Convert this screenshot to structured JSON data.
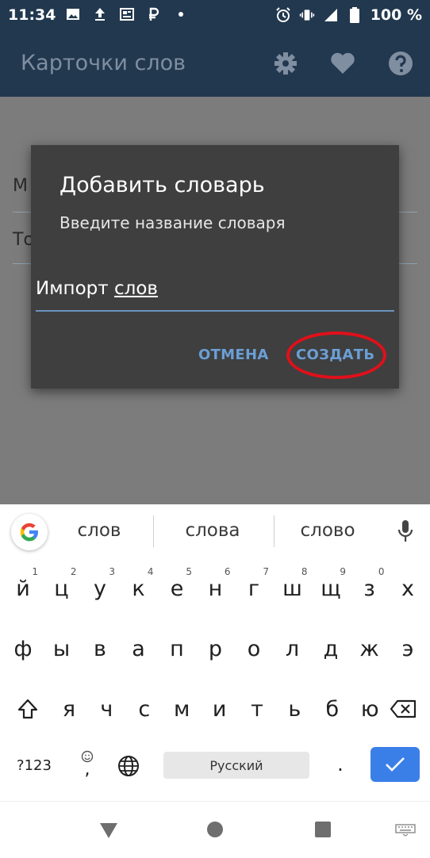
{
  "status_bar": {
    "time": "11:34",
    "battery": "100 %"
  },
  "app_bar": {
    "title": "Карточки слов",
    "icons": [
      "settings-icon",
      "heart-icon",
      "help-icon"
    ]
  },
  "background_list": {
    "items": [
      "М",
      "То"
    ]
  },
  "dialog": {
    "title": "Добавить словарь",
    "message": "Введите название словаря",
    "input_word1": "Импорт",
    "input_word2": "слов",
    "cancel_label": "ОТМЕНА",
    "create_label": "СОЗДАТЬ"
  },
  "keyboard": {
    "suggestions": [
      "слов",
      "слова",
      "слово"
    ],
    "row1": [
      "й",
      "ц",
      "у",
      "к",
      "е",
      "н",
      "г",
      "ш",
      "щ",
      "з",
      "х"
    ],
    "row1_hints": [
      "1",
      "2",
      "3",
      "4",
      "5",
      "6",
      "7",
      "8",
      "9",
      "0",
      ""
    ],
    "row2": [
      "ф",
      "ы",
      "в",
      "а",
      "п",
      "р",
      "о",
      "л",
      "д",
      "ж",
      "э"
    ],
    "row3": [
      "я",
      "ч",
      "с",
      "м",
      "и",
      "т",
      "ь",
      "б",
      "ю"
    ],
    "symbols_label": "?123",
    "space_label": "Русский",
    "period_label": "."
  },
  "colors": {
    "app_bar": "#22384f",
    "accent": "#6b9fd6",
    "highlight": "#e0101a",
    "enter_key": "#3a7fe8"
  }
}
